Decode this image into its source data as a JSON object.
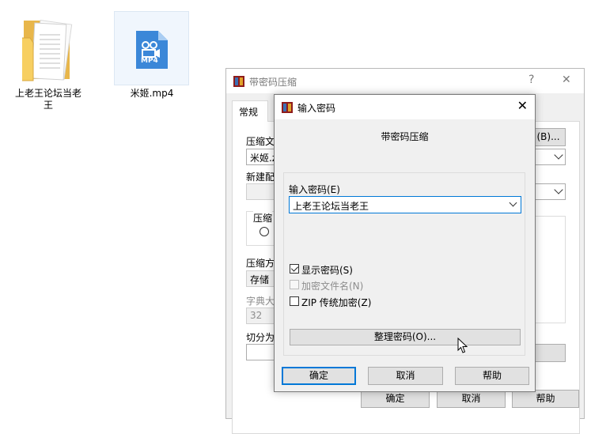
{
  "desktop": {
    "folder_label": "上老王论坛当老王",
    "mp4_label": "米姬.mp4",
    "mp4_badge": "MP4"
  },
  "parent_window": {
    "title": "带密码压缩",
    "help_glyph": "?",
    "close_glyph": "✕",
    "tab_general": "常规",
    "archive_name_label": "压缩文",
    "archive_name_value": "米姬.z",
    "browse_button": "(B)...",
    "new_profile_label": "新建配",
    "format_label": "压缩",
    "method_label": "压缩方",
    "method_value": "存储",
    "dict_label": "字典大",
    "dict_value": "32",
    "split_label": "切分为",
    "ok_button": "确定",
    "cancel_button": "取消",
    "help_button": "帮助"
  },
  "dialog": {
    "title": "输入密码",
    "heading": "带密码压缩",
    "password_label": "输入密码(E)",
    "password_value": "上老王论坛当老王",
    "show_password": "显示密码(S)",
    "encrypt_filenames": "加密文件名(N)",
    "zip_legacy": "ZIP 传统加密(Z)",
    "organize_button": "整理密码(O)...",
    "ok_button": "确定",
    "cancel_button": "取消",
    "help_button": "帮助",
    "close_glyph": "✕",
    "show_password_checked": true,
    "encrypt_filenames_checked": false,
    "zip_legacy_checked": false
  },
  "colors": {
    "accent_focus": "#0078d7",
    "winrar_red": "#8e1b1b",
    "mp4_blue": "#3b87d8",
    "folder_yellow": "#f7cf61"
  }
}
